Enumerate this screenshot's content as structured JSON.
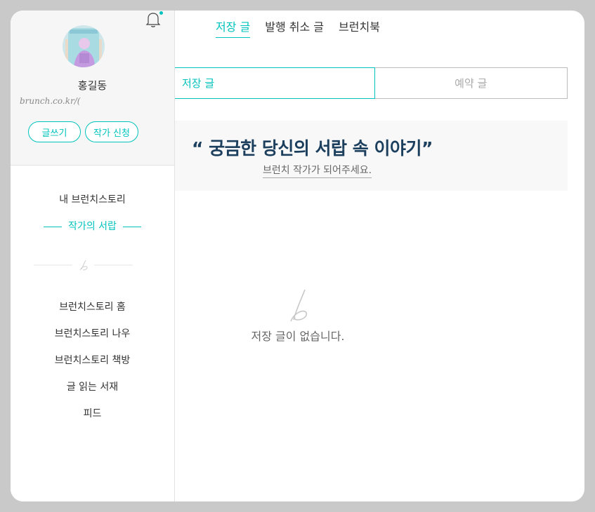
{
  "top_tabs": [
    {
      "label": "저장 글"
    },
    {
      "label": "발행 취소 글"
    },
    {
      "label": "브런치북"
    }
  ],
  "segments": {
    "saved": "저장 글",
    "scheduled": "예약 글"
  },
  "promo": {
    "headline": "“ 궁금한 당신의 서랍 속 이야기”",
    "sub": "브런치 작가가 되어주세요."
  },
  "empty": {
    "message": "저장 글이 없습니다."
  },
  "sidebar": {
    "user_name": "홍길동",
    "user_link": "brunch.co.kr/(",
    "write_label": "글쓰기",
    "apply_label": "작가 신청",
    "menu_top": [
      {
        "label": "내 브런치스토리"
      },
      {
        "label": "작가의 서랍"
      }
    ],
    "menu_bottom": [
      {
        "label": "브런치스토리 홈"
      },
      {
        "label": "브런치스토리 나우"
      },
      {
        "label": "브런치스토리 책방"
      },
      {
        "label": "글 읽는 서재"
      },
      {
        "label": "피드"
      }
    ]
  },
  "colors": {
    "accent": "#00c3bd",
    "headline": "#1d3f5e",
    "backdrop": "#c9c9c9"
  },
  "icons": [
    "bell-icon",
    "brunch-logo-icon"
  ]
}
